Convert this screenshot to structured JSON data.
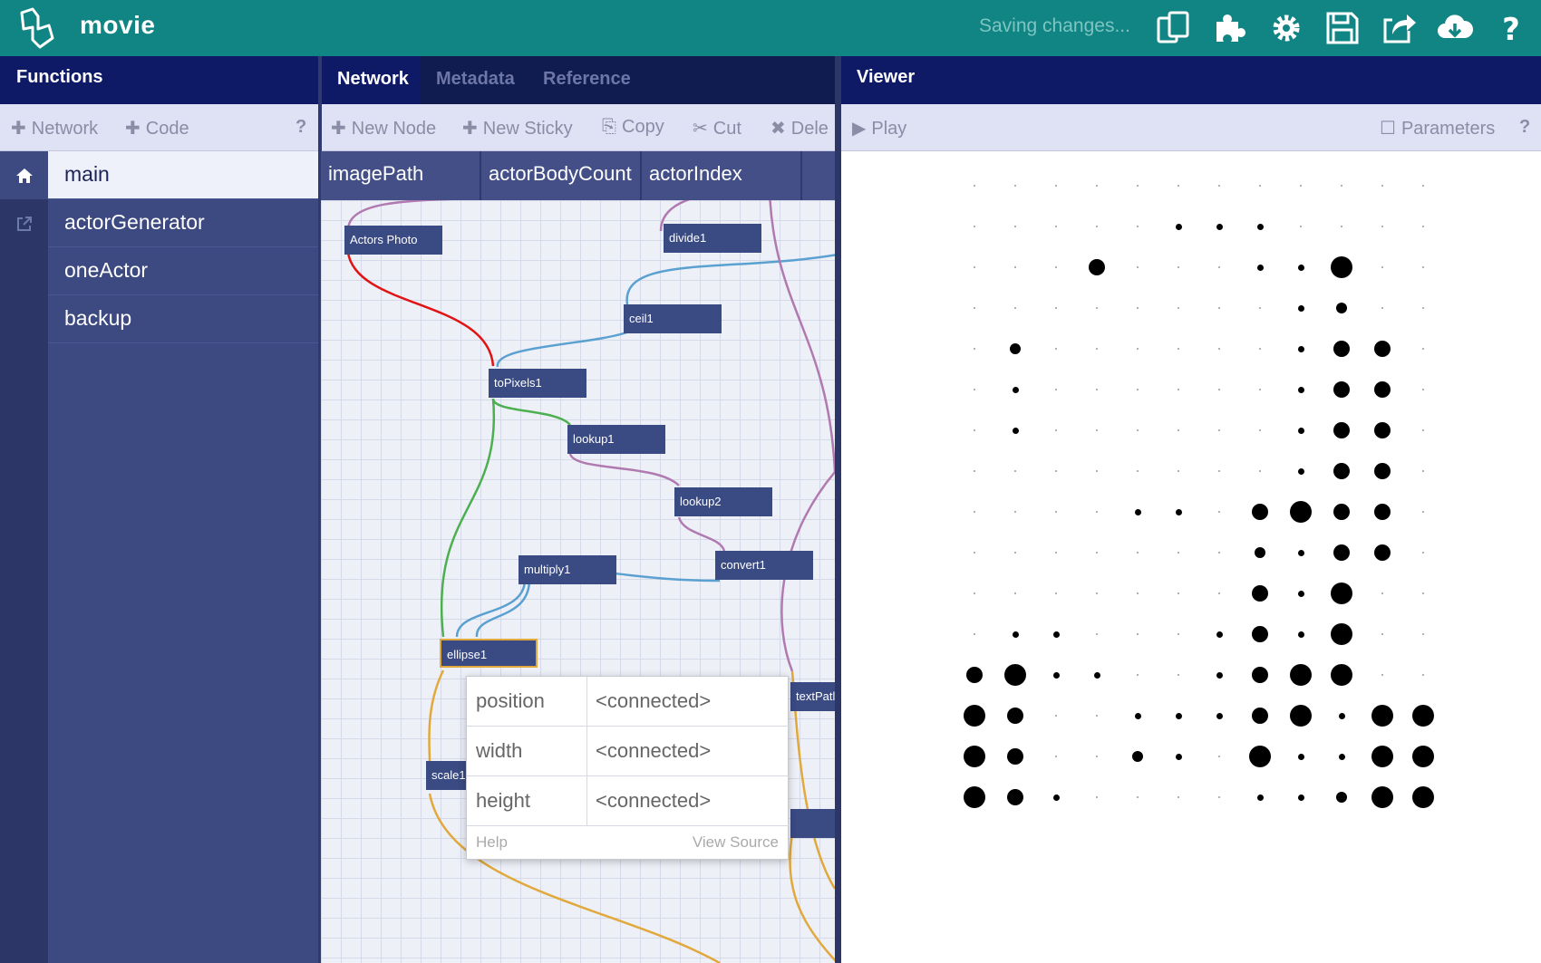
{
  "app": {
    "title": "movie",
    "status": "Saving changes..."
  },
  "toolbar_icons": [
    "documents-icon",
    "puzzle-icon",
    "gear-icon",
    "save-icon",
    "share-icon",
    "cloud-download-icon",
    "help-icon"
  ],
  "functions": {
    "title": "Functions",
    "toolbar": {
      "network": "Network",
      "code": "Code",
      "help": "?"
    },
    "items": [
      "main",
      "actorGenerator",
      "oneActor",
      "backup"
    ],
    "active": "main"
  },
  "network": {
    "tabs": [
      "Network",
      "Metadata",
      "Reference"
    ],
    "toolbar": {
      "new_node": "New Node",
      "new_sticky": "New Sticky",
      "copy": "Copy",
      "cut": "Cut",
      "delete": "Dele"
    },
    "ports": [
      "imagePath",
      "actorBodyCount",
      "actorIndex"
    ],
    "nodes": [
      "Actors Photo",
      "divide1",
      "ceil1",
      "toPixels1",
      "lookup1",
      "lookup2",
      "convert1",
      "multiply1",
      "ellipse1",
      "scale1",
      "textPatl"
    ],
    "popup": {
      "rows": [
        {
          "name": "position",
          "value": "<connected>"
        },
        {
          "name": "width",
          "value": "<connected>"
        },
        {
          "name": "height",
          "value": "<connected>"
        }
      ],
      "help": "Help",
      "view_source": "View Source"
    }
  },
  "viewer": {
    "title": "Viewer",
    "play": "Play",
    "parameters": "Parameters",
    "help": "?",
    "dot_grid": {
      "columns": 12,
      "rows": 16,
      "levels": [
        [
          0,
          0,
          0,
          0,
          0,
          0,
          0,
          0,
          0,
          0,
          0,
          0
        ],
        [
          0,
          0,
          0,
          0,
          0,
          1,
          1,
          1,
          0,
          0,
          0,
          0
        ],
        [
          0,
          0,
          0,
          3,
          0,
          0,
          0,
          1,
          1,
          4,
          0,
          0
        ],
        [
          0,
          0,
          0,
          0,
          0,
          0,
          0,
          0,
          1,
          2,
          0,
          0
        ],
        [
          0,
          2,
          0,
          0,
          0,
          0,
          0,
          0,
          1,
          3,
          3,
          0
        ],
        [
          0,
          1,
          0,
          0,
          0,
          0,
          0,
          0,
          1,
          3,
          3,
          0
        ],
        [
          0,
          1,
          0,
          0,
          0,
          0,
          0,
          0,
          1,
          3,
          3,
          0
        ],
        [
          0,
          0,
          0,
          0,
          0,
          0,
          0,
          0,
          1,
          3,
          3,
          0
        ],
        [
          0,
          0,
          0,
          0,
          1,
          1,
          0,
          3,
          4,
          3,
          3,
          0
        ],
        [
          0,
          0,
          0,
          0,
          0,
          0,
          0,
          2,
          1,
          3,
          3,
          0
        ],
        [
          0,
          0,
          0,
          0,
          0,
          0,
          0,
          3,
          1,
          4,
          0,
          0
        ],
        [
          0,
          1,
          1,
          0,
          0,
          0,
          1,
          3,
          1,
          4,
          0,
          0
        ],
        [
          3,
          4,
          1,
          1,
          0,
          0,
          1,
          3,
          4,
          4,
          0,
          0
        ],
        [
          4,
          3,
          0,
          0,
          1,
          1,
          1,
          3,
          4,
          1,
          4,
          4
        ],
        [
          4,
          3,
          0,
          0,
          2,
          1,
          0,
          4,
          1,
          1,
          4,
          4
        ],
        [
          4,
          3,
          1,
          0,
          0,
          0,
          0,
          1,
          1,
          2,
          4,
          4
        ]
      ]
    }
  }
}
